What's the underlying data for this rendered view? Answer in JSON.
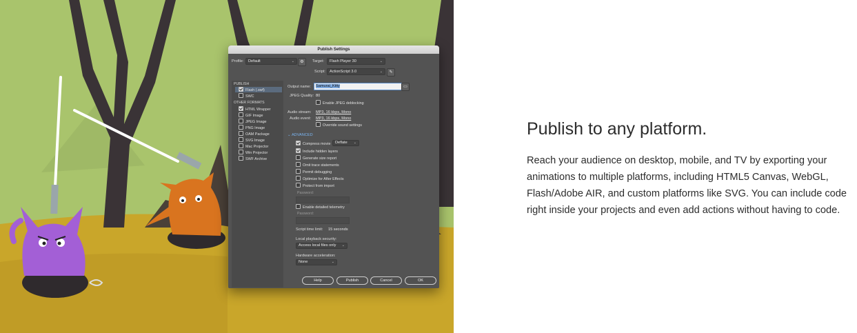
{
  "dialog": {
    "title": "Publish Settings",
    "profile_label": "Profile:",
    "profile_value": "Default",
    "target_label": "Target:",
    "target_value": "Flash Player 30",
    "script_label": "Script:",
    "script_value": "ActionScript 3.0",
    "publish_section": "PUBLISH",
    "publish_items": [
      {
        "label": "Flash (.swf)",
        "checked": true,
        "selected": true
      },
      {
        "label": "SWC",
        "checked": false,
        "selected": false
      }
    ],
    "other_formats_section": "OTHER FORMATS",
    "other_items": [
      {
        "label": "HTML Wrapper",
        "checked": true
      },
      {
        "label": "GIF Image",
        "checked": false
      },
      {
        "label": "JPEG Image",
        "checked": false
      },
      {
        "label": "PNG Image",
        "checked": false
      },
      {
        "label": "OAM Package",
        "checked": false
      },
      {
        "label": "SVG Image",
        "checked": false
      },
      {
        "label": "Mac Projector",
        "checked": false
      },
      {
        "label": "Win Projector",
        "checked": false
      },
      {
        "label": "SWF Archive",
        "checked": false
      }
    ],
    "output_name_label": "Output name:",
    "output_name_value": "Samurai_Kitty",
    "jpeg_quality_label": "JPEG Quality:",
    "jpeg_quality_value": "80",
    "jpeg_deblocking": "Enable JPEG deblocking",
    "audio_stream_label": "Audio stream:",
    "audio_stream_value": "MP3, 16 kbps, Mono",
    "audio_event_label": "Audio event:",
    "audio_event_value": "MP3, 16 kbps, Mono",
    "override_sound": "Override sound settings",
    "advanced_label": "ADVANCED",
    "compress_movie_label": "Compress movie",
    "compress_movie_value": "Deflate",
    "advanced_options": [
      {
        "label": "Include hidden layers",
        "checked": true
      },
      {
        "label": "Generate size report",
        "checked": false
      },
      {
        "label": "Omit trace statements",
        "checked": false
      },
      {
        "label": "Permit debugging",
        "checked": false
      },
      {
        "label": "Optimize for After Effects",
        "checked": false
      },
      {
        "label": "Protect from import",
        "checked": false
      }
    ],
    "password_label": "Password:",
    "telemetry_label": "Enable detailed telemetry",
    "password2_label": "Password:",
    "script_time_label": "Script time limit:",
    "script_time_value": "15 seconds",
    "local_playback_label": "Local playback security:",
    "local_playback_value": "Access local files only",
    "hw_accel_label": "Hardware acceleration:",
    "hw_accel_value": "None",
    "buttons": {
      "help": "Help",
      "publish": "Publish",
      "cancel": "Cancel",
      "ok": "OK"
    }
  },
  "copy": {
    "heading": "Publish to any platform.",
    "body": "Reach your audience on desktop, mobile, and TV by exporting your animations to multiple platforms, including HTML5 Canvas, WebGL, Flash/Adobe AIR, and custom platforms like SVG. You can include code right inside your projects and even add actions without having to code."
  },
  "colors": {
    "sky": "#a9c46c",
    "ground": "#c9a62a",
    "purple_cat": "#a35fd6",
    "orange_cat": "#d9741f",
    "dialog_bg": "#535353",
    "text": "#2c2c2c"
  }
}
